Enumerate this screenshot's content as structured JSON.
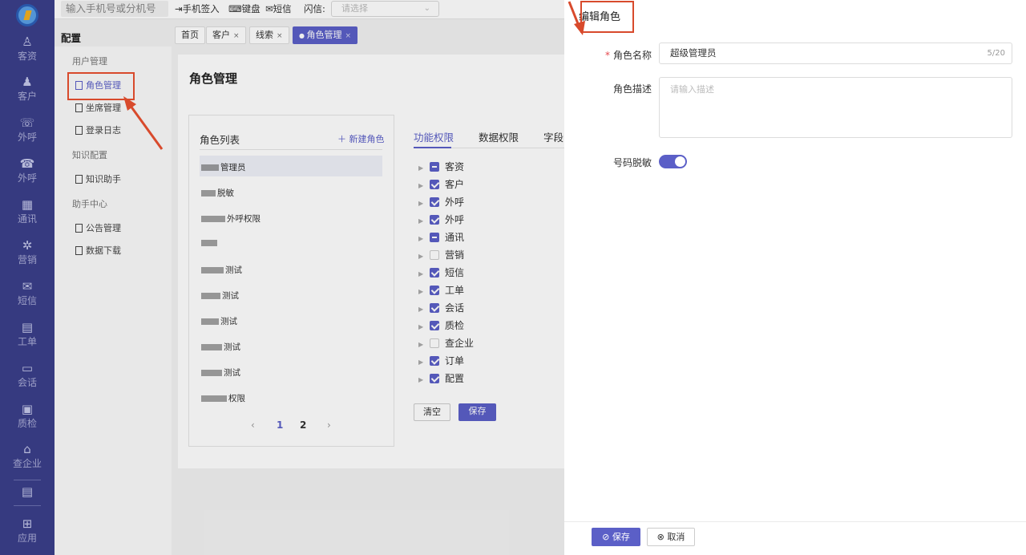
{
  "nav": {
    "items": [
      {
        "icon": "users-icon",
        "glyph": "♙",
        "label": "客资"
      },
      {
        "icon": "customer-icon",
        "glyph": "♟",
        "label": "客户"
      },
      {
        "icon": "phone-icon",
        "glyph": "☏",
        "label": "外呼"
      },
      {
        "icon": "phone-out-icon",
        "glyph": "☎",
        "label": "外呼"
      },
      {
        "icon": "contacts-icon",
        "glyph": "▦",
        "label": "通讯"
      },
      {
        "icon": "marketing-icon",
        "glyph": "✲",
        "label": "营销"
      },
      {
        "icon": "sms-icon",
        "glyph": "✉",
        "label": "短信"
      },
      {
        "icon": "ticket-icon",
        "glyph": "▤",
        "label": "工单"
      },
      {
        "icon": "chat-icon",
        "glyph": "▭",
        "label": "会话"
      },
      {
        "icon": "quality-icon",
        "glyph": "▣",
        "label": "质检"
      },
      {
        "icon": "enterprise-icon",
        "glyph": "⌂",
        "label": "查企业"
      }
    ],
    "extra_icon": "list-icon",
    "app": {
      "icon": "app-icon",
      "glyph": "⊞",
      "label": "应用"
    }
  },
  "topbar": {
    "search_placeholder": "输入手机号或分机号",
    "phone_signin": "手机签入",
    "keyboard": "键盘",
    "sms": "短信",
    "flash_label": "闪信:",
    "flash_select": "请选择"
  },
  "left_panel": {
    "title": "配置",
    "groups": [
      {
        "label": "用户管理",
        "items": [
          "角色管理",
          "坐席管理",
          "登录日志"
        ]
      },
      {
        "label": "知识配置",
        "items": [
          "知识助手"
        ]
      },
      {
        "label": "助手中心",
        "items": [
          "公告管理",
          "数据下载"
        ]
      }
    ]
  },
  "tabs": [
    {
      "label": "首页",
      "closable": false
    },
    {
      "label": "客户",
      "closable": true
    },
    {
      "label": "线索",
      "closable": true
    },
    {
      "label": "角色管理",
      "closable": true,
      "active": true
    }
  ],
  "close_glyph": "×",
  "page_title": "角色管理",
  "role_list": {
    "title": "角色列表",
    "new_button": "＋ 新建角色",
    "items": [
      "管理员",
      "脱敏",
      "外呼权限",
      "",
      "测试",
      "测试",
      "测试",
      "测试",
      "测试",
      "权限"
    ],
    "pagination": {
      "prev": "‹",
      "pages": [
        "1",
        "2"
      ],
      "current": "1",
      "next": "›"
    }
  },
  "perm_tabs": [
    "功能权限",
    "数据权限",
    "字段"
  ],
  "permissions": [
    {
      "label": "客资",
      "state": "half"
    },
    {
      "label": "客户",
      "state": "on"
    },
    {
      "label": "外呼",
      "state": "on"
    },
    {
      "label": "外呼",
      "state": "on"
    },
    {
      "label": "通讯",
      "state": "half"
    },
    {
      "label": "营销",
      "state": "off"
    },
    {
      "label": "短信",
      "state": "on"
    },
    {
      "label": "工单",
      "state": "on"
    },
    {
      "label": "会话",
      "state": "on"
    },
    {
      "label": "质检",
      "state": "on"
    },
    {
      "label": "查企业",
      "state": "off"
    },
    {
      "label": "订单",
      "state": "on"
    },
    {
      "label": "配置",
      "state": "on"
    }
  ],
  "perm_buttons": {
    "clear": "清空",
    "save": "保存"
  },
  "drawer": {
    "title": "编辑角色",
    "name_label": "角色名称",
    "name_value": "超级管理员",
    "name_count": "5/20",
    "desc_label": "角色描述",
    "desc_placeholder": "请输入描述",
    "mask_label": "号码脱敏",
    "mask_on": true,
    "save": "保存",
    "cancel": "取消"
  },
  "colors": {
    "nav_bg": "#3b3f8a",
    "accent": "#5b5fc7",
    "annotation": "#d84a2c"
  }
}
